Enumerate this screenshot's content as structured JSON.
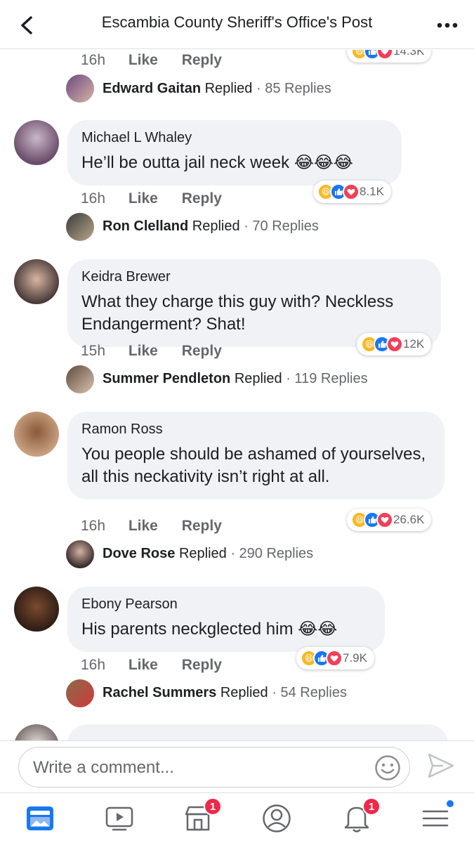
{
  "header": {
    "title": "Escambia County Sheriff's Office's Post"
  },
  "top_stub": {
    "time": "16h",
    "like_label": "Like",
    "reply_label": "Reply",
    "reaction_count": "14.3K",
    "replier": "Edward Gaitan",
    "replied_word": "Replied",
    "reply_count": "· 85 Replies"
  },
  "comments": [
    {
      "author": "Michael L Whaley",
      "text": "He’ll be outta jail neck week 😂😂😂",
      "time": "16h",
      "like_label": "Like",
      "reply_label": "Reply",
      "reaction_count": "8.1K",
      "replier": "Ron Clelland",
      "replied_word": "Replied",
      "reply_count": "· 70 Replies"
    },
    {
      "author": "Keidra Brewer",
      "text": "What they charge this guy with? Neckless Endangerment? Shat!",
      "time": "15h",
      "like_label": "Like",
      "reply_label": "Reply",
      "reaction_count": "12K",
      "replier": "Summer Pendleton",
      "replied_word": "Replied",
      "reply_count": "· 119 Replies"
    },
    {
      "author": "Ramon Ross",
      "text": "You people should be ashamed of yourselves, all this neckativity isn’t right at all.",
      "time": "16h",
      "like_label": "Like",
      "reply_label": "Reply",
      "reaction_count": "26.6K",
      "replier": "Dove Rose",
      "replied_word": "Replied",
      "reply_count": "· 290 Replies"
    },
    {
      "author": "Ebony Pearson",
      "text": "His parents neckglected him 😂😂",
      "time": "16h",
      "like_label": "Like",
      "reply_label": "Reply",
      "reaction_count": "7.9K",
      "replier": "Rachel Summers",
      "replied_word": "Replied",
      "reply_count": "· 54 Replies"
    }
  ],
  "composer": {
    "placeholder": "Write a comment..."
  },
  "tabbar": {
    "marketplace_badge": "1",
    "notifications_badge": "1"
  },
  "colors": {
    "accent": "#1877f2",
    "badge": "#f02849",
    "bubble": "#f0f2f5"
  }
}
